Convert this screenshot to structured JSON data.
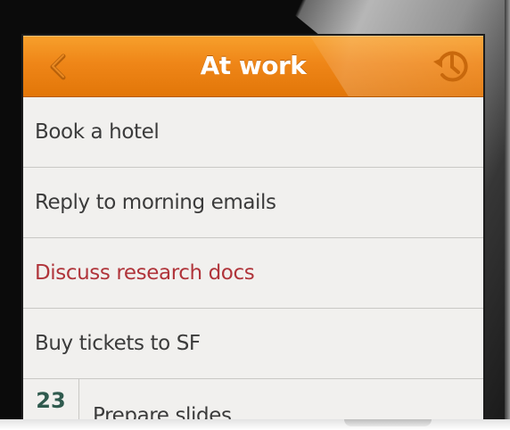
{
  "navbar": {
    "title": "At work",
    "back_icon": "chevron-left-icon",
    "history_icon": "history-clock-icon",
    "accent_color": "#EF8618"
  },
  "tasks": [
    {
      "label": "Book a hotel"
    },
    {
      "label": "Reply to morning emails"
    },
    {
      "label": "Discuss research docs",
      "highlight_color": "#B0343A"
    },
    {
      "label": "Buy tickets to SF"
    },
    {
      "label": "Prepare slides",
      "date_day": "23"
    }
  ]
}
